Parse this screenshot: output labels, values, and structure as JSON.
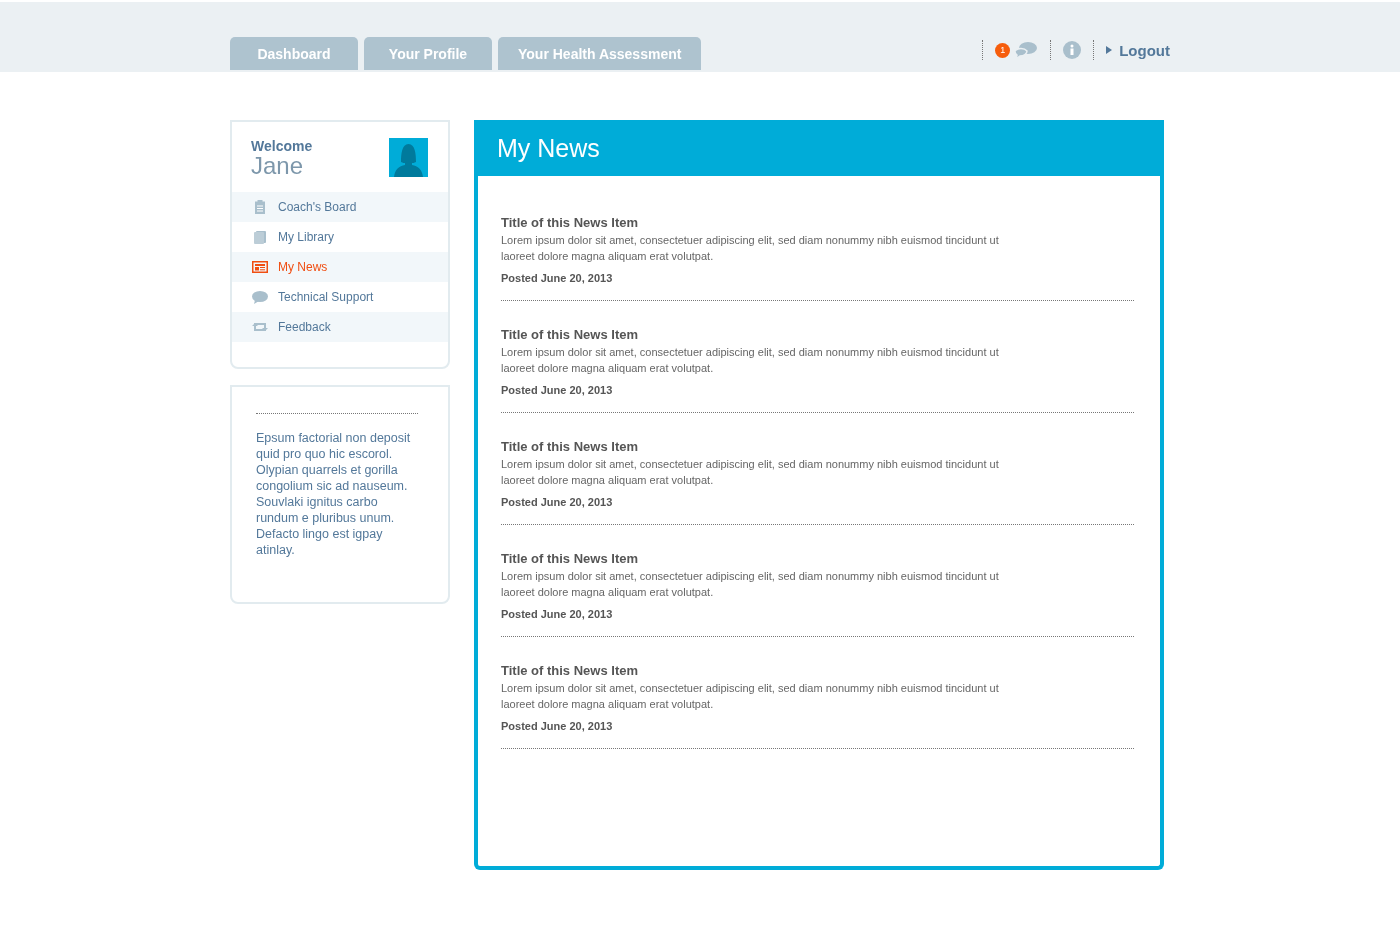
{
  "tabs": [
    {
      "label": "Dashboard",
      "selected": false
    },
    {
      "label": "Your Profile",
      "selected": false
    },
    {
      "label": "Your Health Assessment",
      "selected": false
    }
  ],
  "header": {
    "notification_count": "1",
    "logout": "Logout"
  },
  "sidebar": {
    "welcome": "Welcome",
    "user_name": "Jane",
    "items": [
      {
        "label": "Coach's Board",
        "kind": "clipboard",
        "selected": false
      },
      {
        "label": "My Library",
        "kind": "book",
        "selected": false
      },
      {
        "label": "My News",
        "kind": "newspaper",
        "selected": true
      },
      {
        "label": "Technical Support",
        "kind": "chat",
        "selected": false
      },
      {
        "label": "Feedback",
        "kind": "repeat",
        "selected": false
      }
    ]
  },
  "side_note": "Epsum factorial non deposit quid pro quo hic escorol. Olypian quarrels et gorilla congolium sic ad nauseum. Souvlaki ignitus carbo rundum e pluribus unum. Defacto lingo est igpay atinlay.",
  "news": {
    "title": "My News",
    "items": [
      {
        "title": "Title of this News Item",
        "body": "Lorem ipsum dolor sit amet, consectetuer adipiscing elit, sed diam nonummy nibh euismod tincidunt ut laoreet dolore magna aliquam erat volutpat.",
        "posted": "Posted June 20, 2013"
      },
      {
        "title": "Title of this News Item",
        "body": "Lorem ipsum dolor sit amet, consectetuer adipiscing elit, sed diam nonummy nibh euismod tincidunt ut laoreet dolore magna aliquam erat volutpat.",
        "posted": "Posted June 20, 2013"
      },
      {
        "title": "Title of this News Item",
        "body": "Lorem ipsum dolor sit amet, consectetuer adipiscing elit, sed diam nonummy nibh euismod tincidunt ut laoreet dolore magna aliquam erat volutpat.",
        "posted": "Posted June 20, 2013"
      },
      {
        "title": "Title of this News Item",
        "body": "Lorem ipsum dolor sit amet, consectetuer adipiscing elit, sed diam nonummy nibh euismod tincidunt ut laoreet dolore magna aliquam erat volutpat.",
        "posted": "Posted June 20, 2013"
      },
      {
        "title": "Title of this News Item",
        "body": "Lorem ipsum dolor sit amet, consectetuer adipiscing elit, sed diam nonummy nibh euismod tincidunt ut laoreet dolore magna aliquam erat volutpat.",
        "posted": "Posted June 20, 2013"
      }
    ]
  }
}
